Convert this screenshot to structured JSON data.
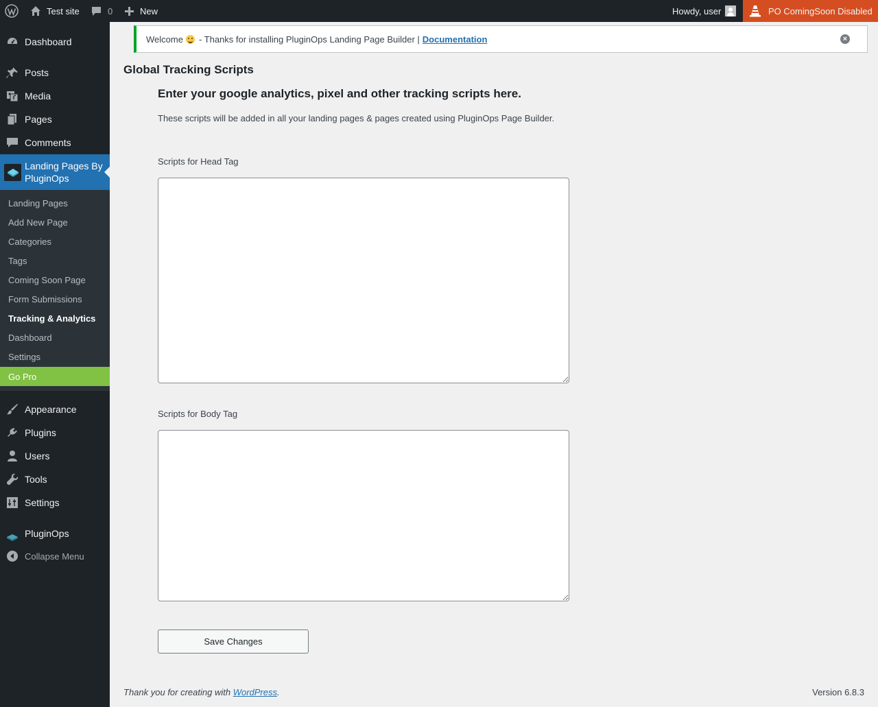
{
  "adminbar": {
    "site_name": "Test site",
    "comments_count": "0",
    "new_label": "New",
    "howdy": "Howdy, user",
    "comingsoon_label": "PO ComingSoon Disabled"
  },
  "sidebar": {
    "dashboard": "Dashboard",
    "posts": "Posts",
    "media": "Media",
    "pages": "Pages",
    "comments": "Comments",
    "landing_pages_line1": "Landing Pages By",
    "landing_pages_line2": "PluginOps",
    "submenu": [
      "Landing Pages",
      "Add New Page",
      "Categories",
      "Tags",
      "Coming Soon Page",
      "Form Submissions",
      "Tracking & Analytics",
      "Dashboard",
      "Settings"
    ],
    "go_pro": "Go Pro",
    "appearance": "Appearance",
    "plugins": "Plugins",
    "users": "Users",
    "tools": "Tools",
    "settings": "Settings",
    "pluginops": "PluginOps",
    "collapse": "Collapse Menu"
  },
  "notice": {
    "welcome": "Welcome",
    "text": "- Thanks for installing PluginOps Landing Page Builder |",
    "link": "Documentation",
    "dismiss": "×"
  },
  "main": {
    "page_title": "Global Tracking Scripts",
    "heading": "Enter your google analytics, pixel and other tracking scripts here.",
    "description": "These scripts will be added in all your landing pages & pages created using PluginOps Page Builder.",
    "head_label": "Scripts for Head Tag",
    "head_value": "",
    "body_label": "Scripts for Body Tag",
    "body_value": "",
    "save_label": "Save Changes"
  },
  "footer": {
    "thanks": "Thank you for creating with",
    "wp_link": "WordPress",
    "period": ".",
    "version": "Version 6.8.3"
  },
  "colors": {
    "adminbar_bg": "#1d2327",
    "active_menu": "#2271b1",
    "go_pro": "#81c244",
    "comingsoon_bg": "#d54e21",
    "notice_border": "#00a32a"
  }
}
